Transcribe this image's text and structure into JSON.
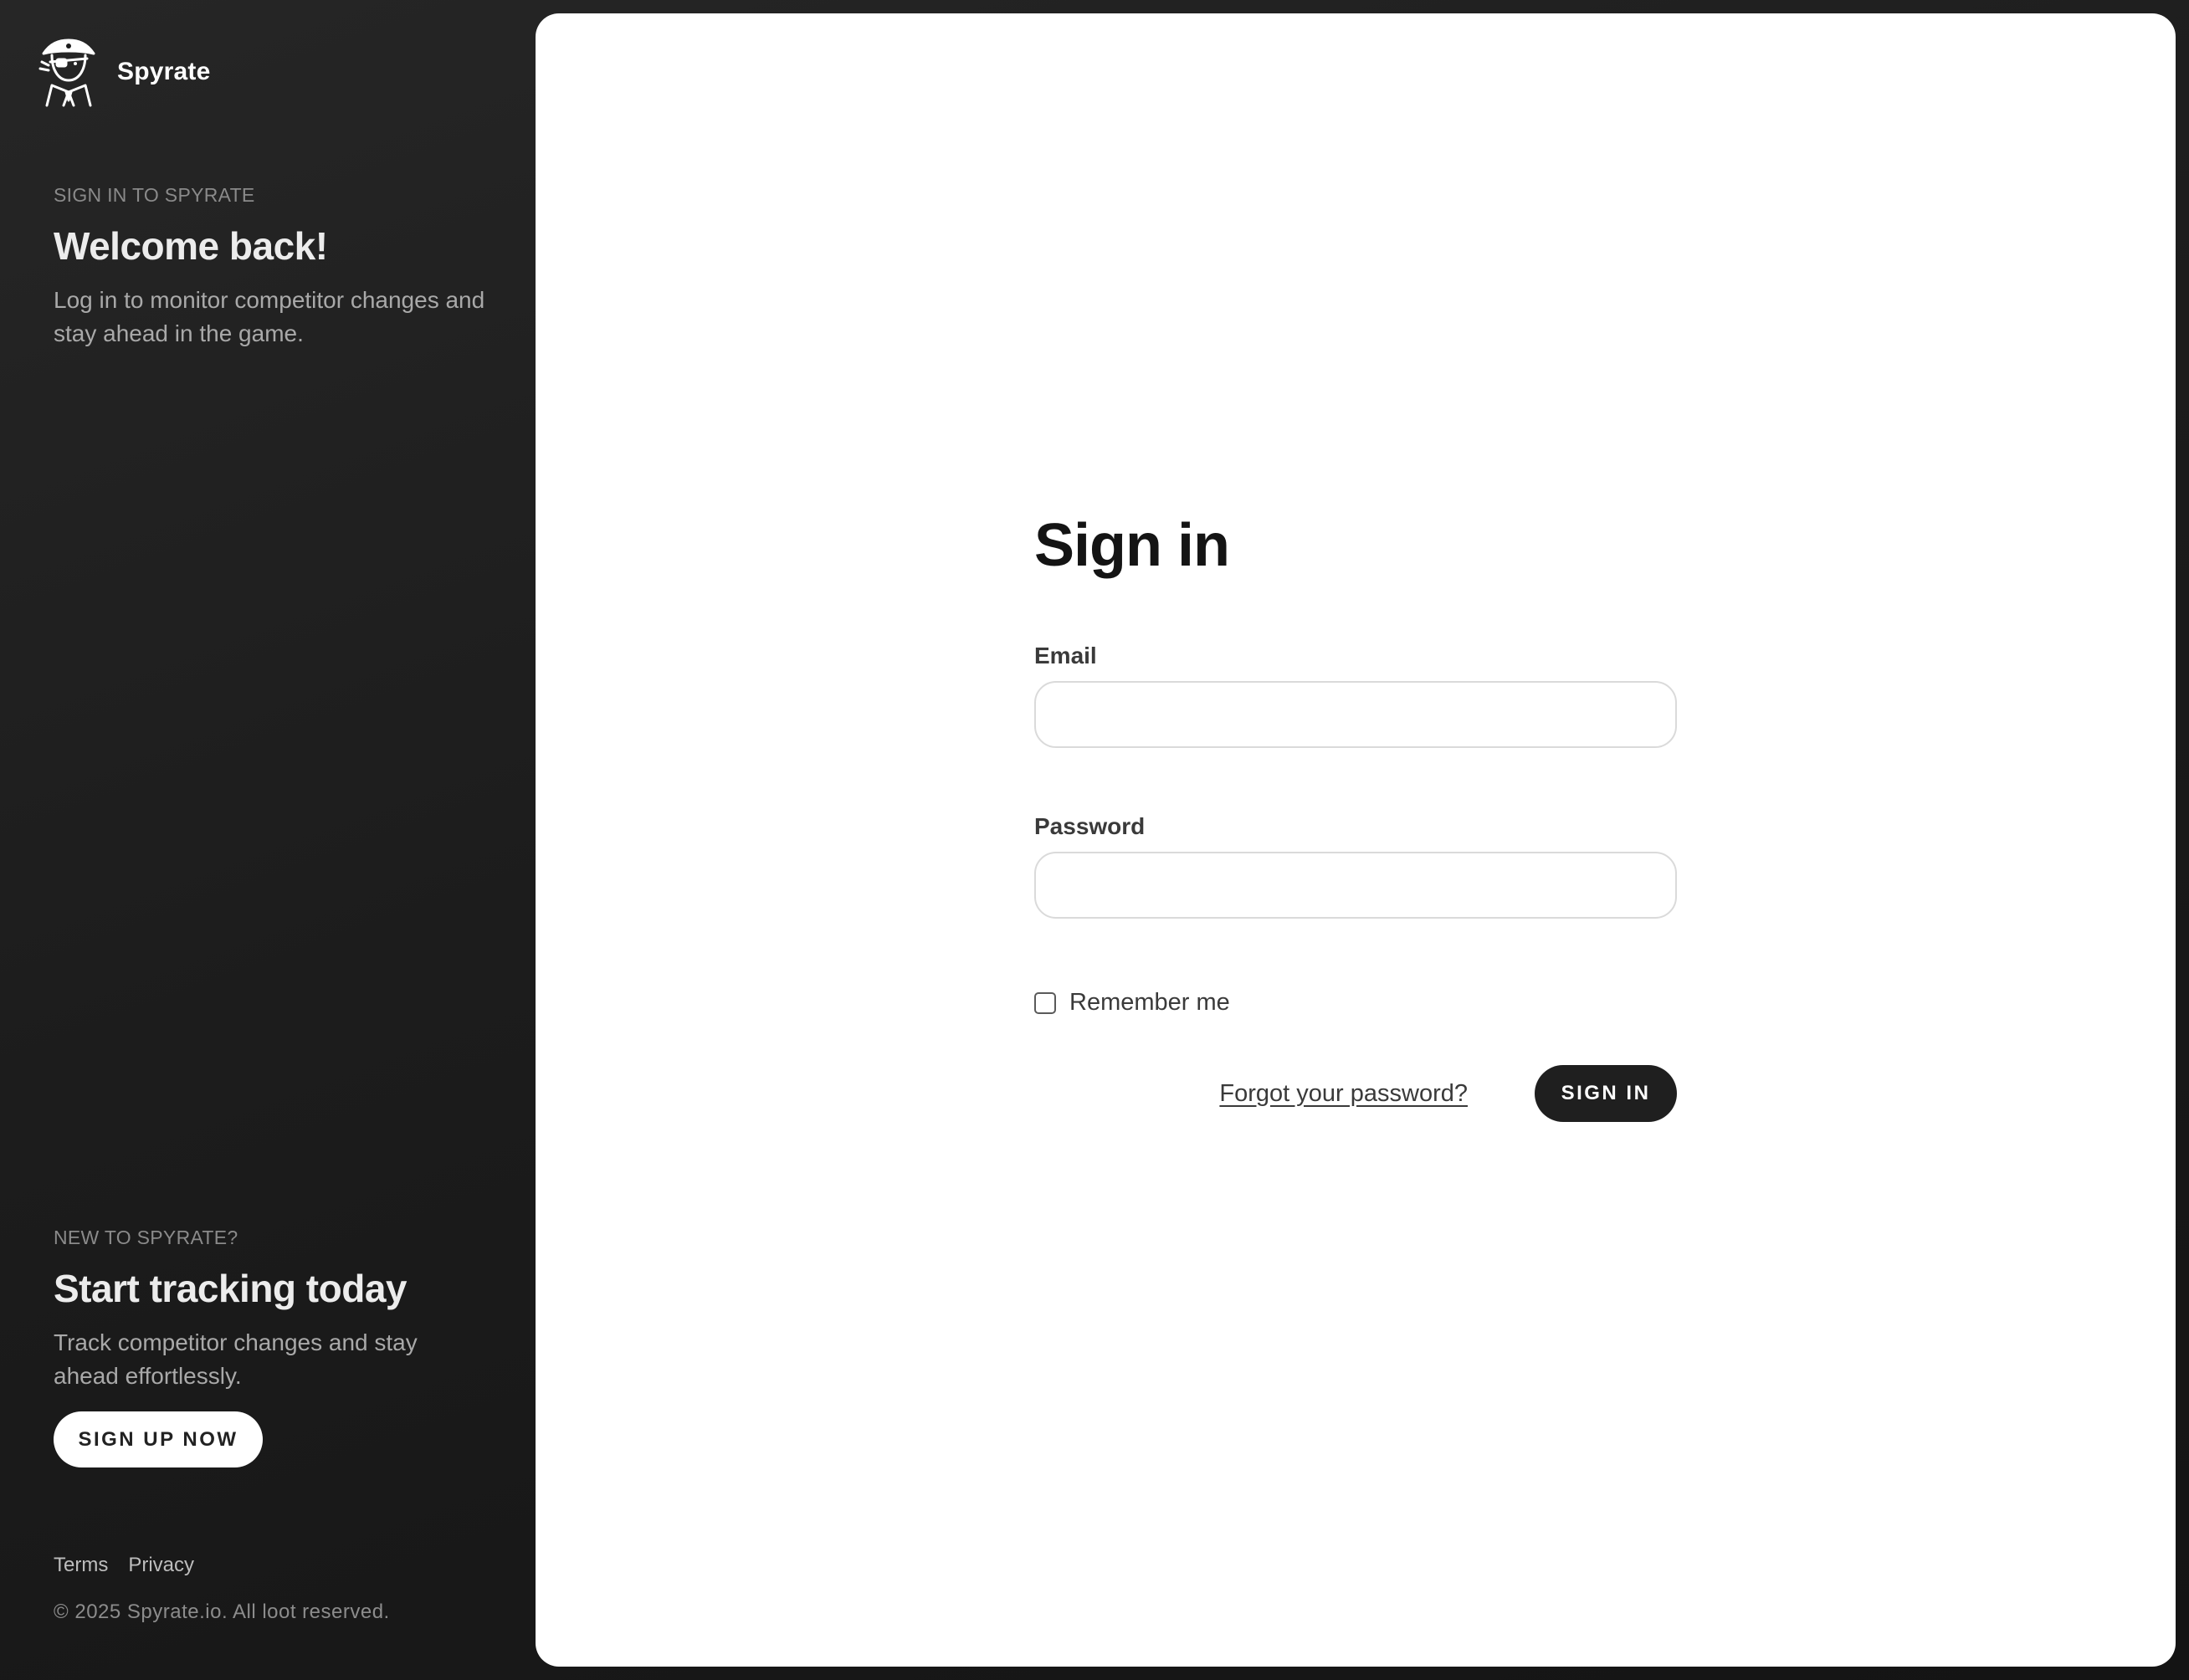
{
  "brand": {
    "name": "Spyrate",
    "logo_icon": "pirate-spy-icon"
  },
  "sidebar": {
    "top": {
      "eyebrow": "SIGN IN TO SPYRATE",
      "title": "Welcome back!",
      "description": "Log in to monitor competitor changes and stay ahead in the game."
    },
    "bottom": {
      "eyebrow": "NEW TO SPYRATE?",
      "title": "Start tracking today",
      "description": "Track competitor changes and stay ahead effortlessly.",
      "cta_label": "SIGN UP NOW"
    },
    "footer": {
      "links": [
        "Terms",
        "Privacy"
      ],
      "copyright": "© 2025 Spyrate.io. All loot reserved."
    }
  },
  "form": {
    "title": "Sign in",
    "email_label": "Email",
    "email_value": "",
    "password_label": "Password",
    "password_value": "",
    "remember_label": "Remember me",
    "remember_checked": false,
    "forgot_label": "Forgot your password?",
    "submit_label": "SIGN IN"
  },
  "colors": {
    "sidebar_bg": "#1c1c1c",
    "panel_bg": "#ffffff",
    "primary_button": "#1f1f1f",
    "text_dark": "#141414",
    "muted": "#8a8a8a"
  }
}
